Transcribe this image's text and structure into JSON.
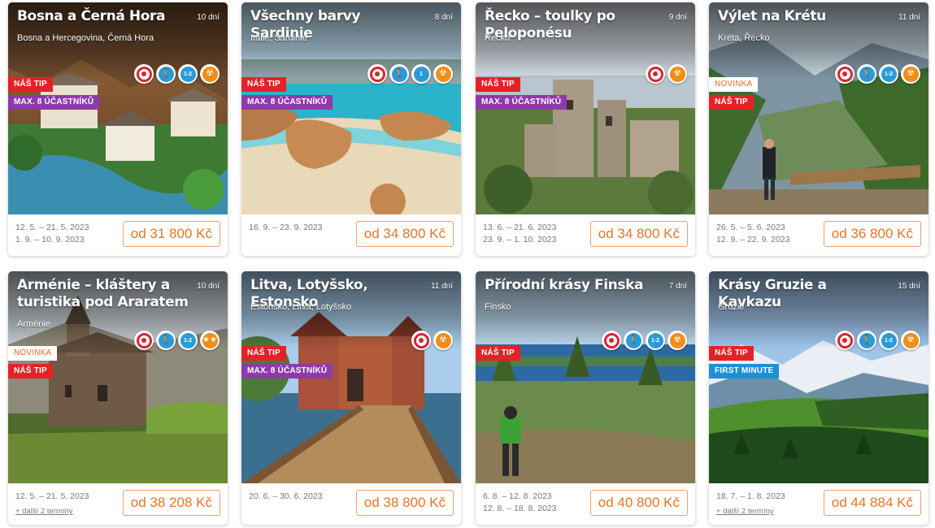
{
  "cards": [
    {
      "title": "Bosna a Černá Hora",
      "days": "10 dní",
      "country": "Bosna a Hercegovina, Černá Hora",
      "badges": [
        {
          "type": "tip",
          "text": "NÁŠ TIP"
        },
        {
          "type": "max",
          "text": "MAX. 8 ÚČASTNÍKŮ"
        }
      ],
      "icons": [
        {
          "name": "eye-icon",
          "kind": "eye",
          "text": ""
        },
        {
          "name": "hiker-icon",
          "kind": "hike",
          "text": "🚶"
        },
        {
          "name": "difficulty-icon",
          "kind": "diff",
          "text": "1-2"
        },
        {
          "name": "food-icon",
          "kind": "food",
          "text": "☢"
        }
      ],
      "dates": [
        "12. 5. – 21. 5. 2023",
        "1. 9. – 10. 9. 2023"
      ],
      "more": "",
      "price": "od 31 800 Kč",
      "scene": "bosnia"
    },
    {
      "title": "Všechny barvy Sardinie",
      "days": "8 dní",
      "country": "Itálie, Sardinie",
      "badges": [
        {
          "type": "tip",
          "text": "NÁŠ TIP"
        },
        {
          "type": "max",
          "text": "MAX. 8 ÚČASTNÍKŮ"
        }
      ],
      "icons": [
        {
          "name": "eye-icon",
          "kind": "eye",
          "text": ""
        },
        {
          "name": "hiker-icon",
          "kind": "hike",
          "text": "🚶"
        },
        {
          "name": "difficulty-icon",
          "kind": "diff",
          "text": "1"
        },
        {
          "name": "food-icon",
          "kind": "food",
          "text": "☢"
        }
      ],
      "dates": [
        "16. 9. – 23. 9. 2023"
      ],
      "more": "",
      "price": "od 34 800 Kč",
      "scene": "beach"
    },
    {
      "title": "Řecko – toulky po Peloponésu",
      "days": "9 dní",
      "country": "Řecko",
      "badges": [
        {
          "type": "tip",
          "text": "NÁŠ TIP"
        },
        {
          "type": "max",
          "text": "MAX. 8 ÚČASTNÍKŮ"
        }
      ],
      "icons": [
        {
          "name": "eye-icon",
          "kind": "eye",
          "text": ""
        },
        {
          "name": "food-icon",
          "kind": "food",
          "text": "☢"
        }
      ],
      "dates": [
        "13. 6. – 21. 6. 2023",
        "23. 9. – 1. 10. 2023"
      ],
      "more": "",
      "price": "od 34 800 Kč",
      "scene": "village"
    },
    {
      "title": "Výlet na Krétu",
      "days": "11 dní",
      "country": "Kréta, Řecko",
      "badges": [
        {
          "type": "nov",
          "text": "NOVINKA"
        },
        {
          "type": "tip",
          "text": "NÁŠ TIP"
        }
      ],
      "icons": [
        {
          "name": "eye-icon",
          "kind": "eye",
          "text": ""
        },
        {
          "name": "hiker-icon",
          "kind": "hike",
          "text": "🚶"
        },
        {
          "name": "difficulty-icon",
          "kind": "diff",
          "text": "1-2"
        },
        {
          "name": "food-icon",
          "kind": "food",
          "text": "☢"
        }
      ],
      "dates": [
        "26. 5. – 5. 6. 2023",
        "12. 9. – 22. 9. 2023"
      ],
      "more": "",
      "price": "od 36 800 Kč",
      "scene": "gorge"
    },
    {
      "title": "Arménie – kláštery a turistika pod Araratem",
      "days": "10 dní",
      "country": "Arménie",
      "badges": [
        {
          "type": "nov",
          "text": "NOVINKA"
        },
        {
          "type": "tip",
          "text": "NÁŠ TIP"
        }
      ],
      "icons": [
        {
          "name": "eye-icon",
          "kind": "eye",
          "text": ""
        },
        {
          "name": "hiker-icon",
          "kind": "hike",
          "text": "🚶"
        },
        {
          "name": "difficulty-icon",
          "kind": "diff",
          "text": "1-2"
        },
        {
          "name": "food-icon",
          "kind": "food",
          "text": "★★"
        }
      ],
      "dates": [
        "12. 5. – 21. 5. 2023"
      ],
      "more": "+ další 2 termíny",
      "price": "od 38 208 Kč",
      "scene": "monastery"
    },
    {
      "title": "Litva, Lotyšsko, Estonsko",
      "days": "11 dní",
      "country": "Estonsko, Litva, Lotyšsko",
      "badges": [
        {
          "type": "tip",
          "text": "NÁŠ TIP"
        },
        {
          "type": "max",
          "text": "MAX. 8 ÚČASTNÍKŮ"
        }
      ],
      "icons": [
        {
          "name": "eye-icon",
          "kind": "eye",
          "text": ""
        },
        {
          "name": "food-icon",
          "kind": "food",
          "text": "☢"
        }
      ],
      "dates": [
        "20. 6. – 30. 6. 2023"
      ],
      "more": "",
      "price": "od 38 800 Kč",
      "scene": "castle"
    },
    {
      "title": "Přírodní krásy Finska",
      "days": "7 dní",
      "country": "Finsko",
      "badges": [
        {
          "type": "tip",
          "text": "NÁŠ TIP"
        }
      ],
      "icons": [
        {
          "name": "eye-icon",
          "kind": "eye",
          "text": ""
        },
        {
          "name": "hiker-icon",
          "kind": "hike",
          "text": "🚶"
        },
        {
          "name": "difficulty-icon",
          "kind": "diff",
          "text": "1-2"
        },
        {
          "name": "food-icon",
          "kind": "food",
          "text": "☢"
        }
      ],
      "dates": [
        "6. 8. – 12. 8. 2023",
        "12. 8. – 18. 8. 2023"
      ],
      "more": "",
      "price": "od 40 800 Kč",
      "scene": "finland"
    },
    {
      "title": "Krásy Gruzie a Kavkazu",
      "days": "15 dní",
      "country": "Gruzie",
      "badges": [
        {
          "type": "tip",
          "text": "NÁŠ TIP"
        },
        {
          "type": "fm",
          "text": "FIRST MINUTE"
        }
      ],
      "icons": [
        {
          "name": "eye-icon",
          "kind": "eye",
          "text": ""
        },
        {
          "name": "hiker-icon",
          "kind": "hike",
          "text": "🚶"
        },
        {
          "name": "difficulty-icon",
          "kind": "diff",
          "text": "1-2"
        },
        {
          "name": "food-icon",
          "kind": "food",
          "text": "☢"
        }
      ],
      "dates": [
        "18. 7. – 1. 8. 2023"
      ],
      "more": "+ další 2 termíny",
      "price": "od 44 884 Kč",
      "scene": "caucasus"
    }
  ]
}
